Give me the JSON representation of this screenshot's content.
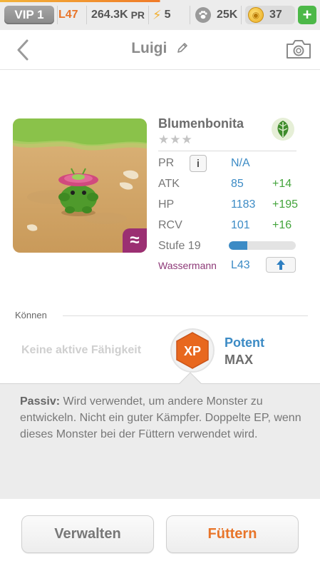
{
  "status_bar": {
    "vip": "VIP 1",
    "level": "L47",
    "power": "264.3K",
    "power_unit": "PR",
    "energy": "5",
    "paws": "25K",
    "coins": "37",
    "add_icon": "plus-icon",
    "accent_color": "#e8752a"
  },
  "nav": {
    "title": "Luigi",
    "back_icon": "chevron-left-icon",
    "edit_icon": "pencil-icon",
    "camera_icon": "camera-icon"
  },
  "monster": {
    "name": "Blumenbonita",
    "stars": "★★★",
    "element_icon": "leaf-icon",
    "stats": {
      "pr_label": "PR",
      "pr_value": "N/A",
      "atk_label": "ATK",
      "atk_value": "85",
      "atk_bonus": "+14",
      "hp_label": "HP",
      "hp_value": "1183",
      "hp_bonus": "+195",
      "rcv_label": "RCV",
      "rcv_value": "101",
      "rcv_bonus": "+16"
    },
    "stufe_label": "Stufe 19",
    "stufe_progress": 0.28,
    "evolution_element": "Wassermann",
    "evolution_level": "L43",
    "badge_symbol": "≈"
  },
  "skills": {
    "section_label": "Können",
    "active_skill": "Keine aktive Fähigkeit",
    "badge_text": "XP",
    "passive_name": "Potent",
    "passive_level": "MAX",
    "passive_label": "Passiv:",
    "passive_description": "Wird verwendet, um andere Monster zu entwickeln. Nicht ein guter Kämpfer. Doppelte EP, wenn dieses Monster bei der Füttern verwendet wird."
  },
  "actions": {
    "manage_label": "Verwalten",
    "feed_label": "Füttern"
  }
}
